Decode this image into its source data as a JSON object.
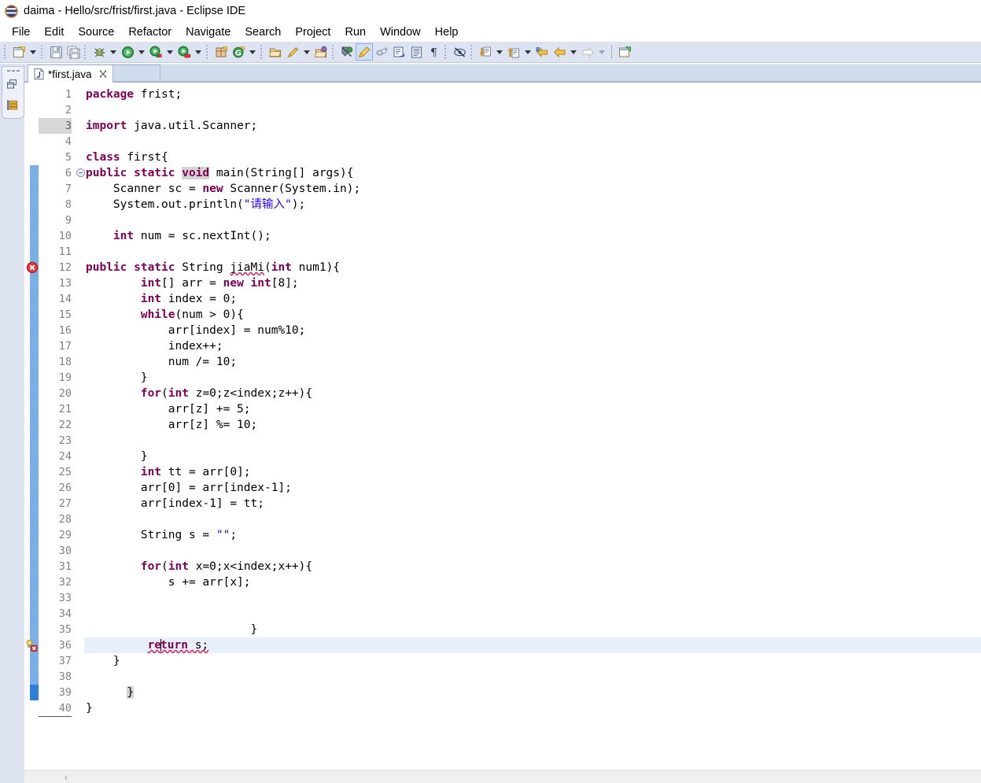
{
  "window": {
    "title": "daima - Hello/src/frist/first.java - Eclipse IDE",
    "app_icon": "eclipse-icon"
  },
  "menubar": {
    "items": [
      {
        "label": "File",
        "name": "menu-file"
      },
      {
        "label": "Edit",
        "name": "menu-edit"
      },
      {
        "label": "Source",
        "name": "menu-source"
      },
      {
        "label": "Refactor",
        "name": "menu-refactor"
      },
      {
        "label": "Navigate",
        "name": "menu-navigate"
      },
      {
        "label": "Search",
        "name": "menu-search"
      },
      {
        "label": "Project",
        "name": "menu-project"
      },
      {
        "label": "Run",
        "name": "menu-run"
      },
      {
        "label": "Window",
        "name": "menu-window"
      },
      {
        "label": "Help",
        "name": "menu-help"
      }
    ]
  },
  "toolbar": {
    "buttons": [
      {
        "name": "new-wizard-icon",
        "tooltip": "New"
      },
      {
        "name": "save-icon",
        "tooltip": "Save"
      },
      {
        "name": "save-all-icon",
        "tooltip": "Save All"
      },
      {
        "name": "debug-icon",
        "tooltip": "Debug"
      },
      {
        "name": "run-icon",
        "tooltip": "Run"
      },
      {
        "name": "run-external-tools-icon",
        "tooltip": "External Tools"
      },
      {
        "name": "coverage-icon",
        "tooltip": "Coverage"
      },
      {
        "name": "new-java-package-icon",
        "tooltip": "New Java Package"
      },
      {
        "name": "new-class-icon",
        "tooltip": "New Java Class"
      },
      {
        "name": "open-type-icon",
        "tooltip": "Open Type"
      },
      {
        "name": "search-pencil-icon",
        "tooltip": "Search"
      },
      {
        "name": "open-task-icon",
        "tooltip": "Open Task"
      },
      {
        "name": "skip-breakpoints-icon",
        "tooltip": "Skip All Breakpoints"
      },
      {
        "name": "toggle-mark-occurrences-icon",
        "tooltip": "Toggle Mark Occurrences"
      },
      {
        "name": "link-with-editor-icon",
        "tooltip": "Link With Editor"
      },
      {
        "name": "next-annotation-icon",
        "tooltip": "Next Annotation"
      },
      {
        "name": "show-whitespace-icon",
        "tooltip": "Show Whitespace Characters"
      },
      {
        "name": "pilcrow-icon",
        "tooltip": "Show Print Margin"
      },
      {
        "name": "toggle-block-selection-icon",
        "tooltip": "Toggle Block Selection"
      },
      {
        "name": "next-edit-position-icon",
        "tooltip": "Next Edit Position"
      },
      {
        "name": "previous-edit-position-icon",
        "tooltip": "Previous Edit Position"
      },
      {
        "name": "back-history-icon",
        "tooltip": "Back"
      },
      {
        "name": "forward-history-icon",
        "tooltip": "Forward"
      },
      {
        "name": "new-window-icon",
        "tooltip": "New Window"
      }
    ]
  },
  "leftbar": {
    "minimized_views": [
      {
        "name": "restore-view-icon",
        "label": "Restore"
      },
      {
        "name": "package-explorer-icon",
        "label": "Package Explorer"
      }
    ]
  },
  "editor": {
    "tab": {
      "label": "*first.java",
      "dirty": true,
      "file_icon": "java-file-icon",
      "close_label": "⌧"
    },
    "current_line": 36,
    "scrollbar": {
      "left_arrow": "‹"
    },
    "lines": [
      {
        "n": 1,
        "indent": 0,
        "changed": false,
        "tokens": [
          {
            "t": "package",
            "c": "kw"
          },
          {
            "t": " frist;",
            "c": "pl"
          }
        ]
      },
      {
        "n": 2,
        "indent": 0,
        "changed": false,
        "tokens": []
      },
      {
        "n": 3,
        "indent": 0,
        "changed": false,
        "numhl": true,
        "tokens": [
          {
            "t": "import",
            "c": "kw"
          },
          {
            "t": " java.util.Scanner;",
            "c": "pl"
          }
        ]
      },
      {
        "n": 4,
        "indent": 0,
        "changed": false,
        "tokens": []
      },
      {
        "n": 5,
        "indent": 0,
        "changed": false,
        "tokens": [
          {
            "t": "class",
            "c": "kw"
          },
          {
            "t": " first{",
            "c": "pl"
          }
        ]
      },
      {
        "n": 6,
        "indent": 0,
        "changed": true,
        "fold": true,
        "tokens": [
          {
            "t": "public static ",
            "c": "kw"
          },
          {
            "t": "void",
            "c": "kw mark"
          },
          {
            "t": " main(String[] args){",
            "c": "pl"
          }
        ]
      },
      {
        "n": 7,
        "indent": 0,
        "changed": true,
        "tokens": [
          {
            "t": "    Scanner sc = ",
            "c": "pl"
          },
          {
            "t": "new",
            "c": "kw"
          },
          {
            "t": " Scanner(System.in);",
            "c": "pl"
          }
        ]
      },
      {
        "n": 8,
        "indent": 0,
        "changed": true,
        "tokens": [
          {
            "t": "    System.out.println(",
            "c": "pl"
          },
          {
            "t": "\"请输入\"",
            "c": "str"
          },
          {
            "t": ");",
            "c": "pl"
          }
        ]
      },
      {
        "n": 9,
        "indent": 0,
        "changed": true,
        "tokens": []
      },
      {
        "n": 10,
        "indent": 0,
        "changed": true,
        "tokens": [
          {
            "t": "    ",
            "c": "pl"
          },
          {
            "t": "int",
            "c": "kw"
          },
          {
            "t": " num = sc.nextInt();",
            "c": "pl"
          }
        ]
      },
      {
        "n": 11,
        "indent": 0,
        "changed": true,
        "tokens": []
      },
      {
        "n": 12,
        "indent": 0,
        "changed": true,
        "marker": "error",
        "tokens": [
          {
            "t": "public static ",
            "c": "kw"
          },
          {
            "t": "String ",
            "c": "pl"
          },
          {
            "t": "jiaMi",
            "c": "pl err-underline"
          },
          {
            "t": "(",
            "c": "pl"
          },
          {
            "t": "int",
            "c": "kw"
          },
          {
            "t": " num1){",
            "c": "pl"
          }
        ]
      },
      {
        "n": 13,
        "indent": 0,
        "changed": true,
        "tokens": [
          {
            "t": "        ",
            "c": "pl"
          },
          {
            "t": "int",
            "c": "kw"
          },
          {
            "t": "[] arr = ",
            "c": "pl"
          },
          {
            "t": "new int",
            "c": "kw"
          },
          {
            "t": "[8];",
            "c": "pl"
          }
        ]
      },
      {
        "n": 14,
        "indent": 0,
        "changed": true,
        "tokens": [
          {
            "t": "        ",
            "c": "pl"
          },
          {
            "t": "int",
            "c": "kw"
          },
          {
            "t": " index = 0;",
            "c": "pl"
          }
        ]
      },
      {
        "n": 15,
        "indent": 0,
        "changed": true,
        "tokens": [
          {
            "t": "        ",
            "c": "pl"
          },
          {
            "t": "while",
            "c": "kw"
          },
          {
            "t": "(num > 0){",
            "c": "pl"
          }
        ]
      },
      {
        "n": 16,
        "indent": 0,
        "changed": true,
        "tokens": [
          {
            "t": "            arr[index] = num%10;",
            "c": "pl"
          }
        ]
      },
      {
        "n": 17,
        "indent": 0,
        "changed": true,
        "tokens": [
          {
            "t": "            index++;",
            "c": "pl"
          }
        ]
      },
      {
        "n": 18,
        "indent": 0,
        "changed": true,
        "tokens": [
          {
            "t": "            num /= 10;",
            "c": "pl"
          }
        ]
      },
      {
        "n": 19,
        "indent": 0,
        "changed": true,
        "tokens": [
          {
            "t": "        }",
            "c": "pl"
          }
        ]
      },
      {
        "n": 20,
        "indent": 0,
        "changed": true,
        "tokens": [
          {
            "t": "        ",
            "c": "pl"
          },
          {
            "t": "for",
            "c": "kw"
          },
          {
            "t": "(",
            "c": "pl"
          },
          {
            "t": "int",
            "c": "kw"
          },
          {
            "t": " z=0;z<index;z++){",
            "c": "pl"
          }
        ]
      },
      {
        "n": 21,
        "indent": 0,
        "changed": true,
        "tokens": [
          {
            "t": "            arr[z] += 5;",
            "c": "pl"
          }
        ]
      },
      {
        "n": 22,
        "indent": 0,
        "changed": true,
        "tokens": [
          {
            "t": "            arr[z] %= 10;",
            "c": "pl"
          }
        ]
      },
      {
        "n": 23,
        "indent": 0,
        "changed": true,
        "tokens": []
      },
      {
        "n": 24,
        "indent": 0,
        "changed": true,
        "tokens": [
          {
            "t": "        }",
            "c": "pl"
          }
        ]
      },
      {
        "n": 25,
        "indent": 0,
        "changed": true,
        "tokens": [
          {
            "t": "        ",
            "c": "pl"
          },
          {
            "t": "int",
            "c": "kw"
          },
          {
            "t": " tt = arr[0];",
            "c": "pl"
          }
        ]
      },
      {
        "n": 26,
        "indent": 0,
        "changed": true,
        "tokens": [
          {
            "t": "        arr[0] = arr[index-1];",
            "c": "pl"
          }
        ]
      },
      {
        "n": 27,
        "indent": 0,
        "changed": true,
        "tokens": [
          {
            "t": "        arr[index-1] = tt;",
            "c": "pl"
          }
        ]
      },
      {
        "n": 28,
        "indent": 0,
        "changed": true,
        "tokens": []
      },
      {
        "n": 29,
        "indent": 0,
        "changed": true,
        "tokens": [
          {
            "t": "        String s = ",
            "c": "pl"
          },
          {
            "t": "\"\"",
            "c": "str"
          },
          {
            "t": ";",
            "c": "pl"
          }
        ]
      },
      {
        "n": 30,
        "indent": 0,
        "changed": true,
        "tokens": []
      },
      {
        "n": 31,
        "indent": 0,
        "changed": true,
        "tokens": [
          {
            "t": "        ",
            "c": "pl"
          },
          {
            "t": "for",
            "c": "kw"
          },
          {
            "t": "(",
            "c": "pl"
          },
          {
            "t": "int",
            "c": "kw"
          },
          {
            "t": " x=0;x<index;x++){",
            "c": "pl"
          }
        ]
      },
      {
        "n": 32,
        "indent": 0,
        "changed": true,
        "tokens": [
          {
            "t": "            s += arr[x];",
            "c": "pl"
          }
        ]
      },
      {
        "n": 33,
        "indent": 0,
        "changed": true,
        "tokens": []
      },
      {
        "n": 34,
        "indent": 0,
        "changed": true,
        "tokens": []
      },
      {
        "n": 35,
        "indent": 0,
        "changed": true,
        "tokens": [
          {
            "t": "                        }",
            "c": "pl"
          }
        ]
      },
      {
        "n": 36,
        "indent": 0,
        "changed": true,
        "current": true,
        "marker": "error-fix",
        "tokens": [
          {
            "t": "         ",
            "c": "pl"
          },
          {
            "t": "re",
            "c": "kw err-underline"
          },
          {
            "t": "CARET",
            "c": "caret"
          },
          {
            "t": "turn",
            "c": "kw err-underline"
          },
          {
            "t": " s;",
            "c": "pl err-underline"
          }
        ]
      },
      {
        "n": 37,
        "indent": 0,
        "changed": true,
        "tokens": [
          {
            "t": "    }",
            "c": "pl"
          }
        ]
      },
      {
        "n": 38,
        "indent": 0,
        "changed": true,
        "tokens": []
      },
      {
        "n": 39,
        "indent": 0,
        "changed": true,
        "changed_solid": true,
        "tokens": [
          {
            "t": "      ",
            "c": "pl"
          },
          {
            "t": "}",
            "c": "pl mark"
          }
        ]
      },
      {
        "n": 40,
        "indent": 0,
        "changed": false,
        "numlast": true,
        "tokens": [
          {
            "t": "}",
            "c": "pl"
          }
        ]
      }
    ]
  },
  "colors": {
    "keyword": "#7f0055",
    "string": "#2a00ff",
    "plain": "#000000",
    "current_line_bg": "#e8f0fb",
    "change_bar": "#4a90e2",
    "error_squiggle": "#d81e5b",
    "toolbar_bg": "#dde3f0",
    "occurrence_mark": "#d4d4d4"
  }
}
